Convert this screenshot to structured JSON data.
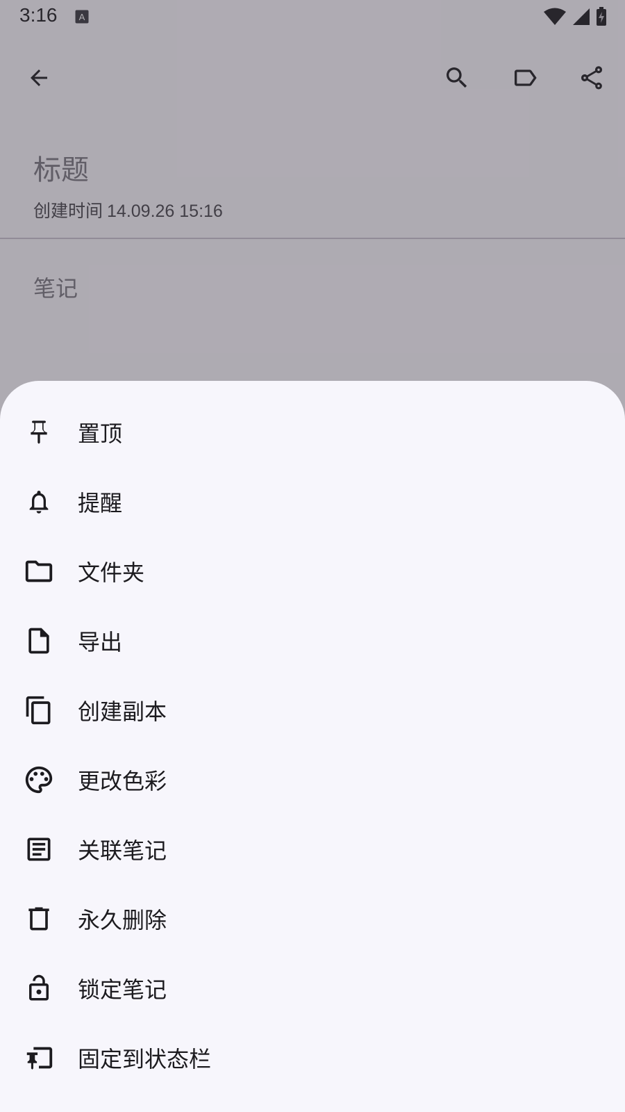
{
  "status_bar": {
    "time": "3:16",
    "icons": [
      "text-a-icon",
      "wifi-icon",
      "signal-icon",
      "battery-charging-icon"
    ]
  },
  "app_bar": {
    "actions": [
      "back-arrow-icon",
      "search-icon",
      "label-icon",
      "share-icon"
    ]
  },
  "note": {
    "title_placeholder": "标题",
    "created_label": "创建时间",
    "created_value": "14.09.26 15:16",
    "body_placeholder": "笔记"
  },
  "sheet": {
    "items": [
      {
        "label": "置顶",
        "icon": "pin-icon"
      },
      {
        "label": "提醒",
        "icon": "bell-icon"
      },
      {
        "label": "文件夹",
        "icon": "folder-icon"
      },
      {
        "label": "导出",
        "icon": "file-icon"
      },
      {
        "label": "创建副本",
        "icon": "copy-icon"
      },
      {
        "label": "更改色彩",
        "icon": "palette-icon"
      },
      {
        "label": "关联笔记",
        "icon": "note-link-icon"
      },
      {
        "label": "永久删除",
        "icon": "trash-icon"
      },
      {
        "label": "锁定笔记",
        "icon": "lock-icon"
      },
      {
        "label": "固定到状态栏",
        "icon": "pin-statusbar-icon"
      }
    ]
  },
  "colors": {
    "sheet_background": "#f7f6fc",
    "scrim": "#3c3842",
    "text_primary": "#1c1b1f",
    "text_hint": "#7a7880"
  }
}
